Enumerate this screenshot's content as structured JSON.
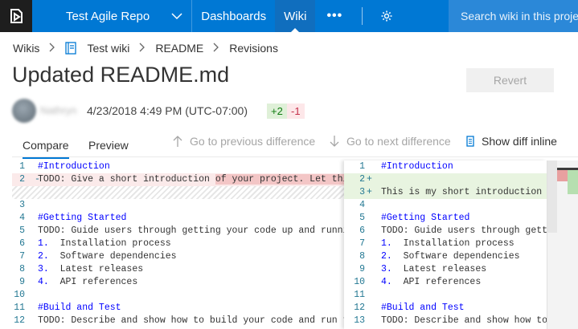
{
  "nav": {
    "repo_name": "Test Agile Repo",
    "items": [
      {
        "label": "Dashboards"
      },
      {
        "label": "Wiki"
      }
    ],
    "more_label": "•••",
    "search_placeholder": "Search wiki in this proje"
  },
  "breadcrumb": [
    "Wikis",
    "Test wiki",
    "README",
    "Revisions"
  ],
  "page": {
    "title": "Updated README.md",
    "revert_label": "Revert"
  },
  "commit": {
    "author": "Nathryn",
    "date": "4/23/2018 4:49 PM (UTC-07:00)",
    "additions": "+2",
    "deletions": "-1"
  },
  "toolbar": {
    "tabs": [
      "Compare",
      "Preview"
    ],
    "prev_diff": "Go to previous difference",
    "next_diff": "Go to next difference",
    "inline_label": "Show diff inline"
  },
  "diff": {
    "left": [
      {
        "n": "1",
        "pre": "",
        "hl": "",
        "post": "#Introduction",
        "cls": "kw"
      },
      {
        "n": "2",
        "mk": "-",
        "pre": "TODO: Give a short introduction ",
        "hl": "of your project. Let this",
        "post": "",
        "type": "del"
      },
      {
        "n": "",
        "type": "filler",
        "pre": "",
        "hl": "",
        "post": ""
      },
      {
        "n": "3",
        "pre": "",
        "hl": "",
        "post": ""
      },
      {
        "n": "4",
        "pre": "",
        "hl": "",
        "post": "#Getting Started",
        "cls": "kw"
      },
      {
        "n": "5",
        "pre": "",
        "hl": "",
        "post": "TODO: Guide users through getting your code up and running"
      },
      {
        "n": "6",
        "pre": "",
        "hl": "",
        "post": "1.  Installation process",
        "listnum": true
      },
      {
        "n": "7",
        "pre": "",
        "hl": "",
        "post": "2.  Software dependencies",
        "listnum": true
      },
      {
        "n": "8",
        "pre": "",
        "hl": "",
        "post": "3.  Latest releases",
        "listnum": true
      },
      {
        "n": "9",
        "pre": "",
        "hl": "",
        "post": "4.  API references",
        "listnum": true
      },
      {
        "n": "10",
        "pre": "",
        "hl": "",
        "post": ""
      },
      {
        "n": "11",
        "pre": "",
        "hl": "",
        "post": "#Build and Test",
        "cls": "kw"
      },
      {
        "n": "12",
        "pre": "",
        "hl": "",
        "post": "TODO: Describe and show how to build your code and run the"
      }
    ],
    "right": [
      {
        "n": "1",
        "post": "#Introduction",
        "cls": "kw"
      },
      {
        "n": "2",
        "mk": "+",
        "post": "",
        "type": "add"
      },
      {
        "n": "3",
        "mk": "+",
        "post": "This is my short introduction t",
        "type": "add"
      },
      {
        "n": "4",
        "post": ""
      },
      {
        "n": "5",
        "post": "#Getting Started",
        "cls": "kw"
      },
      {
        "n": "6",
        "post": "TODO: Guide users through gett:"
      },
      {
        "n": "7",
        "post": "1.  Installation process",
        "listnum": true
      },
      {
        "n": "8",
        "post": "2.  Software dependencies",
        "listnum": true
      },
      {
        "n": "9",
        "post": "3.  Latest releases",
        "listnum": true
      },
      {
        "n": "10",
        "post": "4.  API references",
        "listnum": true
      },
      {
        "n": "11",
        "post": ""
      },
      {
        "n": "12",
        "post": "#Build and Test",
        "cls": "kw"
      },
      {
        "n": "13",
        "post": "TODO: Describe and show how to"
      }
    ]
  },
  "colors": {
    "nav_bg": "#0078d4",
    "accent": "#0078d4",
    "added": "#107c10",
    "deleted": "#c4314b"
  }
}
